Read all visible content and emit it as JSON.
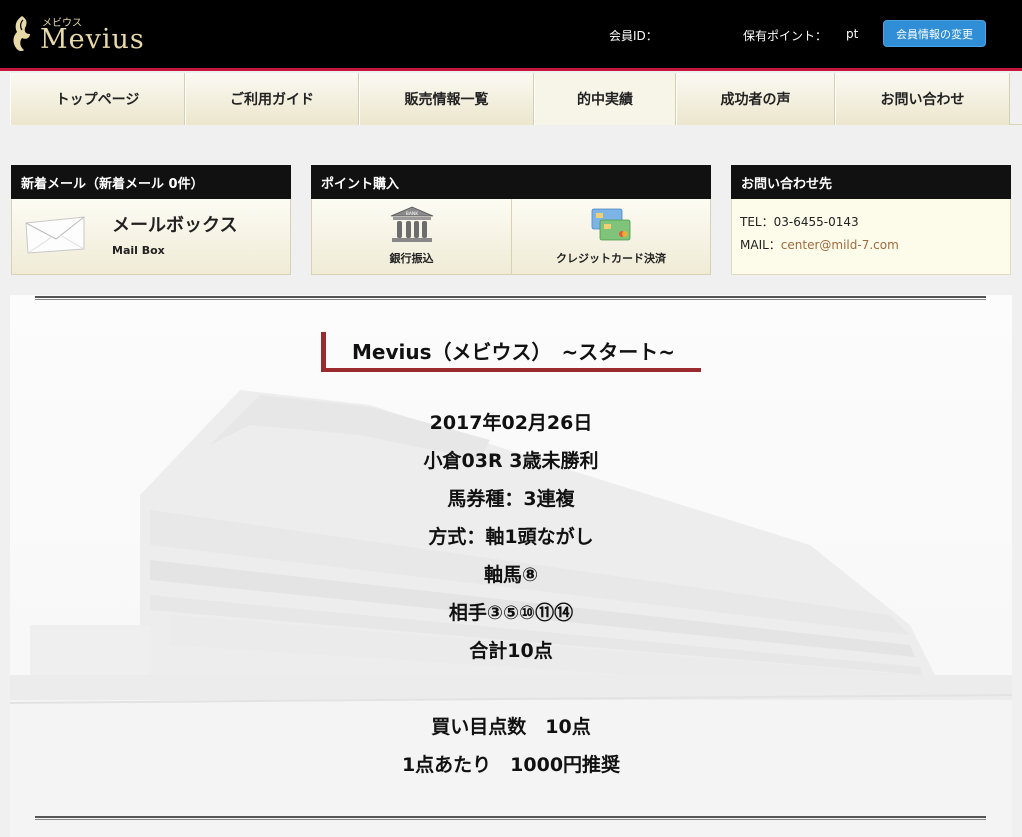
{
  "header": {
    "logo_kana": "メビウス",
    "logo_word": "Mevius",
    "member_id_label": "会員ID：",
    "points_label": "保有ポイント：",
    "points_unit": "pt",
    "change_button": "会員情報の変更"
  },
  "nav": {
    "items": [
      {
        "label": "トップページ"
      },
      {
        "label": "ご利用ガイド"
      },
      {
        "label": "販売情報一覧"
      },
      {
        "label": "的中実績"
      },
      {
        "label": "成功者の声"
      },
      {
        "label": "お問い合わせ"
      }
    ]
  },
  "mail_panel": {
    "heading": "新着メール（新着メール 0件）",
    "title": "メールボックス",
    "subtitle": "Mail Box"
  },
  "point_panel": {
    "heading": "ポイント購入",
    "bank_label": "銀行振込",
    "bank_sign": "BANK",
    "card_label": "クレジットカード決済"
  },
  "contact_panel": {
    "heading": "お問い合わせ先",
    "tel": "TEL：03-6455-0143",
    "mail_label": "MAIL：",
    "mail_address": "center@mild-7.com"
  },
  "article": {
    "title": "Mevius（メビウス）　~スタート~",
    "lines": [
      "2017年02月26日",
      "小倉03R 3歳未勝利",
      "馬券種：3連複",
      "方式：軸1頭ながし",
      "軸馬⑧",
      "相手③⑤⑩⑪⑭",
      "合計10点"
    ],
    "summary": [
      "買い目点数　10点",
      "1点あたり　1000円推奨"
    ]
  },
  "colors": {
    "header_bg": "#000000",
    "accent_red": "#c4183a",
    "button_blue": "#2f8ed5",
    "title_rule": "#9b2a2e"
  }
}
